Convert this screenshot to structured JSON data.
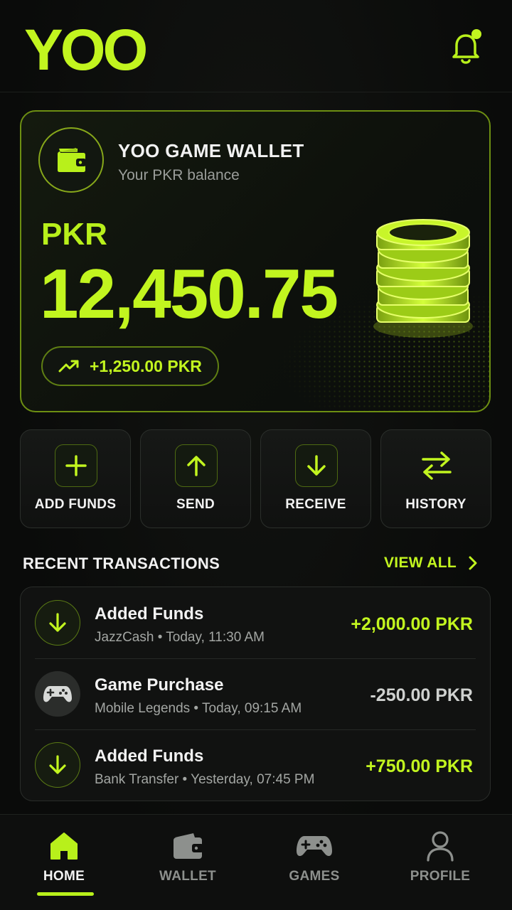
{
  "header": {
    "logo_text": "YOO",
    "notification_icon": "bell-icon",
    "has_notification_dot": true
  },
  "wallet": {
    "title": "YOO GAME WALLET",
    "subtitle": "Your PKR balance",
    "currency": "PKR",
    "balance": "12,450.75",
    "change": "+1,250.00 PKR",
    "icon": "wallet-icon"
  },
  "actions": [
    {
      "label": "ADD FUNDS",
      "icon": "plus-icon"
    },
    {
      "label": "SEND",
      "icon": "arrow-up-icon"
    },
    {
      "label": "RECEIVE",
      "icon": "arrow-down-icon"
    },
    {
      "label": "HISTORY",
      "icon": "swap-arrows-icon"
    }
  ],
  "transactions": {
    "title": "RECENT TRANSACTIONS",
    "view_all": "VIEW ALL",
    "items": [
      {
        "name": "Added Funds",
        "source": "JazzCash",
        "time": "Today, 11:30 AM",
        "amount": "+2,000.00 PKR",
        "type": "credit",
        "icon": "arrow-down-icon"
      },
      {
        "name": "Game Purchase",
        "source": "Mobile Legends",
        "time": "Today, 09:15 AM",
        "amount": "-250.00 PKR",
        "type": "debit",
        "icon": "gamepad-icon"
      },
      {
        "name": "Added Funds",
        "source": "Bank Transfer",
        "time": "Yesterday, 07:45 PM",
        "amount": "+750.00 PKR",
        "type": "credit",
        "icon": "arrow-down-icon"
      }
    ]
  },
  "nav": [
    {
      "label": "HOME",
      "icon": "home-icon",
      "active": true
    },
    {
      "label": "WALLET",
      "icon": "wallet-icon",
      "active": false
    },
    {
      "label": "GAMES",
      "icon": "gamepad-icon",
      "active": false
    },
    {
      "label": "PROFILE",
      "icon": "user-icon",
      "active": false
    }
  ],
  "colors": {
    "accent": "#c2f51f",
    "background": "#0b0c0b",
    "card": "#111211"
  }
}
